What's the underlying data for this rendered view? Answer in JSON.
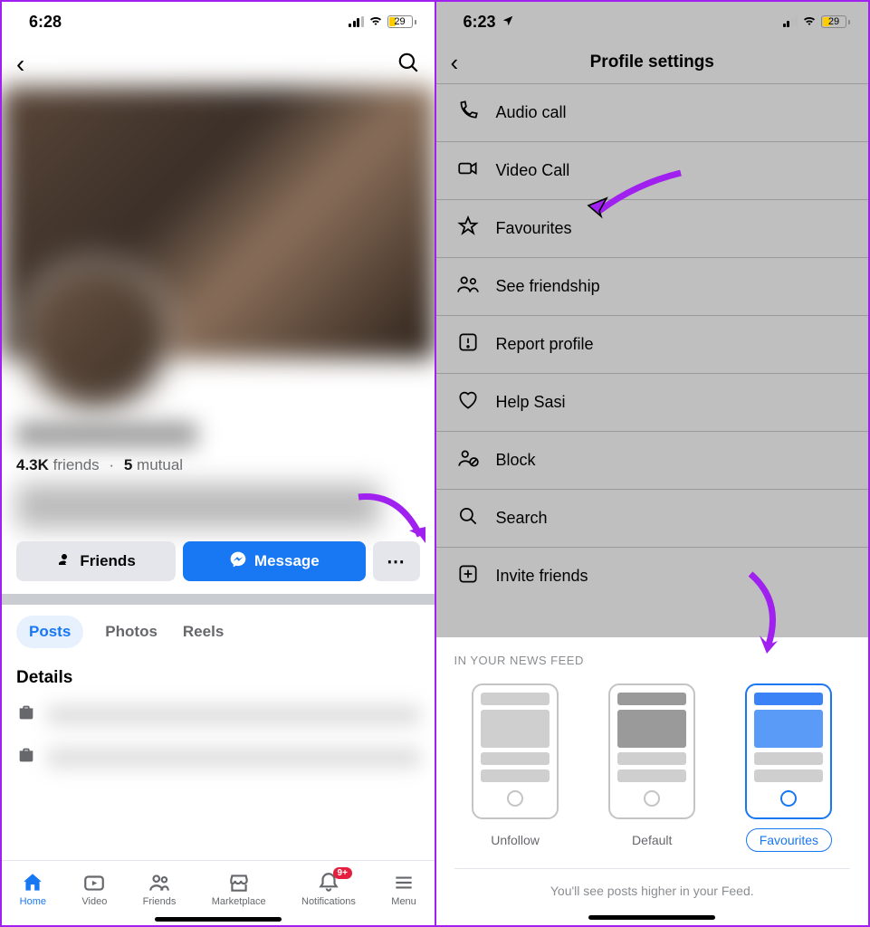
{
  "left": {
    "status": {
      "time": "6:28",
      "battery": "29"
    },
    "friends_count": "4.3K",
    "friends_label": "friends",
    "mutual_count": "5",
    "mutual_label": "mutual",
    "buttons": {
      "friends": "Friends",
      "message": "Message",
      "more": "⋯"
    },
    "tabs": {
      "posts": "Posts",
      "photos": "Photos",
      "reels": "Reels"
    },
    "details_title": "Details",
    "nav": {
      "home": "Home",
      "video": "Video",
      "friends": "Friends",
      "marketplace": "Marketplace",
      "notifications": "Notifications",
      "menu": "Menu",
      "badge": "9+"
    }
  },
  "right": {
    "status": {
      "time": "6:23",
      "battery": "29"
    },
    "title": "Profile settings",
    "items": {
      "audio": "Audio call",
      "video": "Video Call",
      "favourites": "Favourites",
      "friendship": "See friendship",
      "report": "Report profile",
      "help": "Help Sasi",
      "block": "Block",
      "search": "Search",
      "invite": "Invite friends"
    },
    "sheet": {
      "title": "IN YOUR NEWS FEED",
      "unfollow": "Unfollow",
      "default": "Default",
      "favourites": "Favourites",
      "note": "You'll see posts higher in your Feed."
    }
  }
}
